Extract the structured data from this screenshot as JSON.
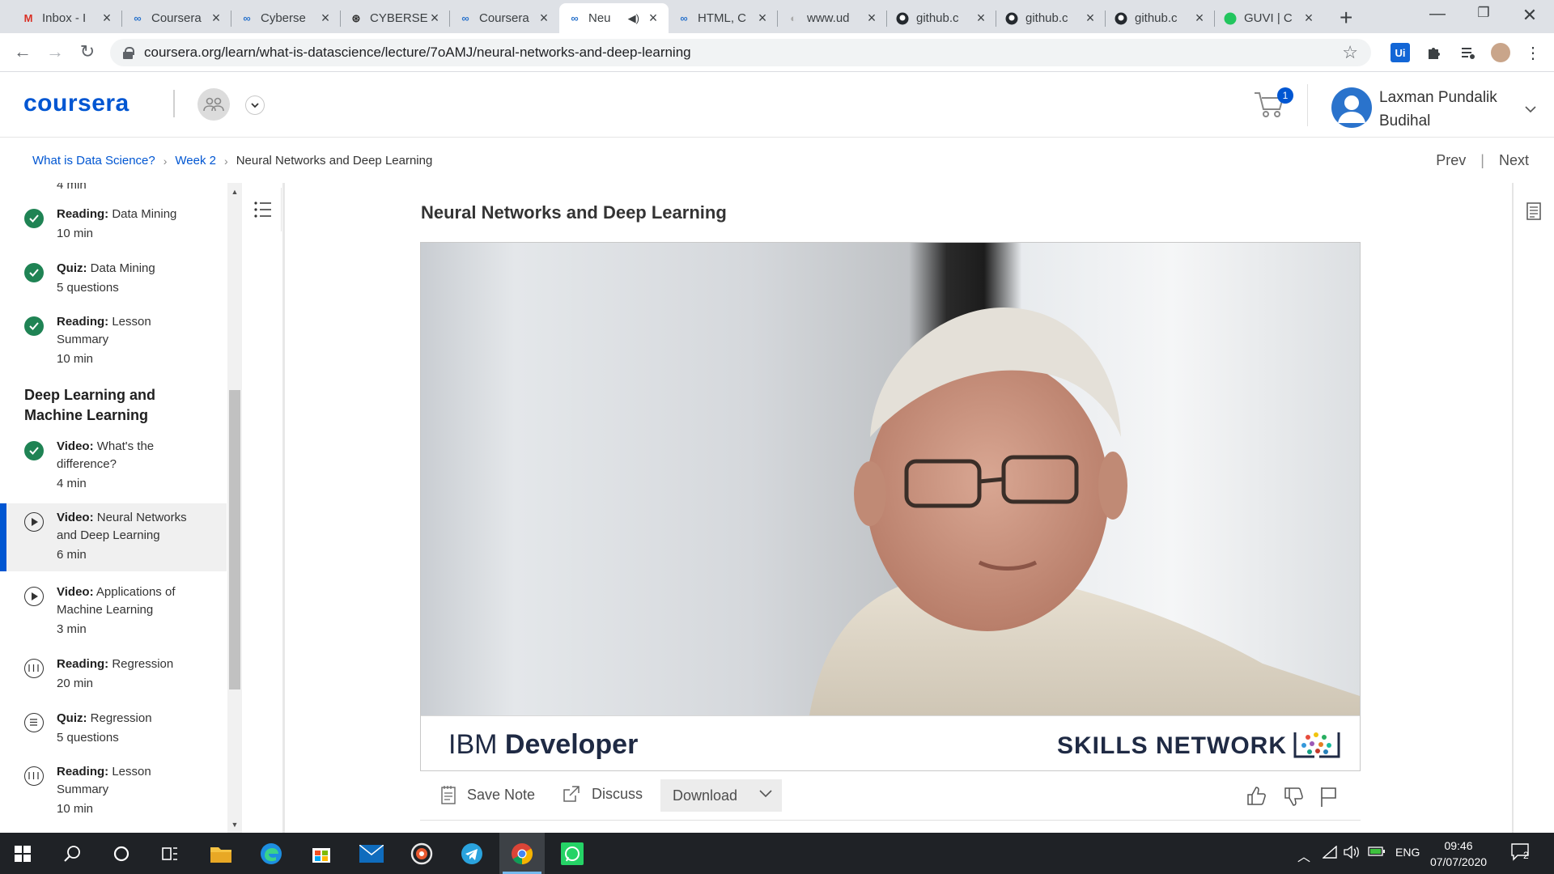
{
  "browser": {
    "tabs": [
      {
        "title": "Inbox - I",
        "favicon": "gmail-icon"
      },
      {
        "title": "Coursera",
        "favicon": "coursera-icon"
      },
      {
        "title": "Cyberse",
        "favicon": "coursera-icon"
      },
      {
        "title": "CYBERSE",
        "favicon": "cybersec-icon"
      },
      {
        "title": "Coursera",
        "favicon": "coursera-icon"
      },
      {
        "title": "Neu",
        "favicon": "coursera-icon",
        "active": true,
        "audio": true
      },
      {
        "title": "HTML, C",
        "favicon": "coursera-icon"
      },
      {
        "title": "www.ud",
        "favicon": "udemy-icon"
      },
      {
        "title": "github.c",
        "favicon": "github-icon"
      },
      {
        "title": "github.c",
        "favicon": "github-icon"
      },
      {
        "title": "github.c",
        "favicon": "github-icon"
      },
      {
        "title": "GUVI | C",
        "favicon": "guvi-icon"
      }
    ],
    "url": "coursera.org/learn/what-is-datascience/lecture/7oAMJ/neural-networks-and-deep-learning"
  },
  "header": {
    "logo": "coursera",
    "cart_count": "1",
    "user_name": "Laxman Pundalik Budihal"
  },
  "breadcrumb": {
    "course": "What is Data Science?",
    "week": "Week 2",
    "current": "Neural Networks and Deep Learning"
  },
  "nav": {
    "prev": "Prev",
    "next": "Next"
  },
  "sidebar": {
    "top_partial": "4 min",
    "items": [
      {
        "type": "Reading:",
        "title": "Data Mining",
        "meta": "10 min",
        "status": "done"
      },
      {
        "type": "Quiz:",
        "title": "Data Mining",
        "meta": "5 questions",
        "status": "done"
      },
      {
        "type": "Reading:",
        "title": "Lesson Summary",
        "meta": "10 min",
        "status": "done"
      },
      {
        "type": "Video:",
        "title": "What's the difference?",
        "meta": "4 min",
        "status": "done"
      },
      {
        "type": "Video:",
        "title": "Neural Networks and Deep Learning",
        "meta": "6 min",
        "status": "video",
        "active": true
      },
      {
        "type": "Video:",
        "title": "Applications of Machine Learning",
        "meta": "3 min",
        "status": "video"
      },
      {
        "type": "Reading:",
        "title": "Regression",
        "meta": "20 min",
        "status": "reading"
      },
      {
        "type": "Quiz:",
        "title": "Regression",
        "meta": "5 questions",
        "status": "quiz"
      },
      {
        "type": "Reading:",
        "title": "Lesson Summary",
        "meta": "10 min",
        "status": "reading"
      }
    ],
    "section_title": "Deep Learning and Machine Learning"
  },
  "lecture": {
    "title": "Neural Networks and Deep Learning",
    "video_brand_left_light": "IBM",
    "video_brand_left_bold": "Developer",
    "video_brand_right": "SKILLS NETWORK"
  },
  "actions": {
    "save_note": "Save Note",
    "discuss": "Discuss",
    "download": "Download"
  },
  "taskbar": {
    "language": "ENG",
    "time": "09:46",
    "date": "07/07/2020",
    "notifications": "2"
  },
  "colors": {
    "brand": "#0056d2",
    "complete": "#1f8354",
    "taskbar": "#1f2226"
  }
}
